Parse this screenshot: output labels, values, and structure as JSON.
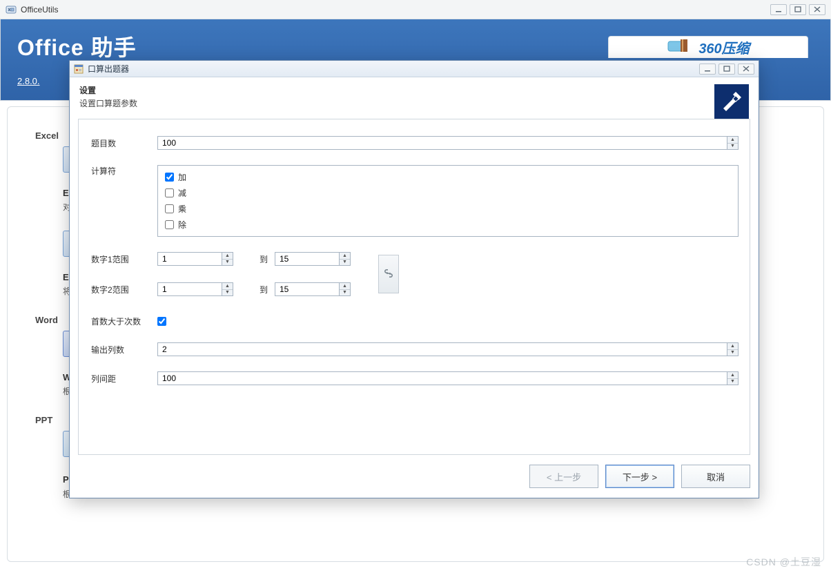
{
  "parent": {
    "title": "OfficeUtils",
    "banner_title": "Office 助手",
    "version": "2.8.0.",
    "ad_text": "360压缩",
    "categories": [
      {
        "name": "Excel",
        "items": [
          {
            "name": "Excel",
            "desc": "对 E"
          },
          {
            "name": "Excel",
            "desc": "将 E"
          }
        ]
      },
      {
        "name": "Word",
        "items": [
          {
            "name": "Word",
            "desc": "根据"
          }
        ]
      },
      {
        "name": "PPT",
        "items": [
          {
            "name": "PPT 模板页面生成",
            "desc": "根据 PPT 模板和 Excel 数据，自动生成 PPT 页面。"
          }
        ]
      }
    ]
  },
  "dialog": {
    "title": "口算出题器",
    "header_title": "设置",
    "header_sub": "设置口算题参数",
    "labels": {
      "count": "题目数",
      "ops": "计算符",
      "range1": "数字1范围",
      "range2": "数字2范围",
      "to": "到",
      "first_gt": "首数大于次数",
      "cols": "输出列数",
      "gap": "列间距"
    },
    "values": {
      "count": "100",
      "range1_from": "1",
      "range1_to": "15",
      "range2_from": "1",
      "range2_to": "15",
      "first_gt_checked": true,
      "cols": "2",
      "gap": "100"
    },
    "ops": [
      {
        "label": "加",
        "checked": true
      },
      {
        "label": "减",
        "checked": false
      },
      {
        "label": "乘",
        "checked": false
      },
      {
        "label": "除",
        "checked": false
      }
    ],
    "buttons": {
      "back": "< 上一步",
      "next": "下一步 >",
      "cancel": "取消"
    }
  },
  "watermark": "CSDN @土豆湿"
}
